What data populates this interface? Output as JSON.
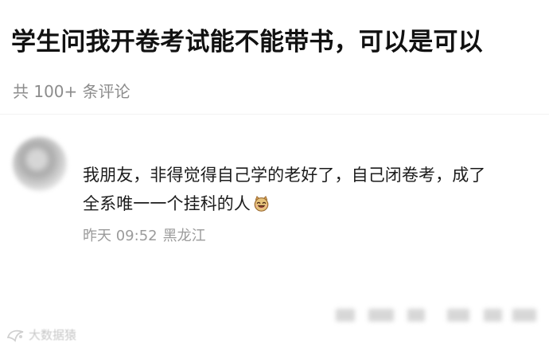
{
  "post": {
    "title": "学生问我开卷考试能不能带书，可以是可以",
    "comment_count": "共 100+ 条评论"
  },
  "comment": {
    "avatar": "blurred-avatar",
    "username": "",
    "text_line_1": "我朋友，非得觉得自己学的老好了，自己闭卷考，成了",
    "text_line_2": "全系唯一一个挂科的人",
    "emoji": "laughing-face-emoji",
    "time": "昨天 09:52",
    "location": "黑龙江"
  },
  "footer": {
    "watermark_text": "大数据猿",
    "watermark_icon": "watermark-logo-icon"
  },
  "colors": {
    "background": "#ffffff",
    "title": "#111111",
    "body_text": "#1b1b1b",
    "muted_text": "#8c8c8c",
    "meta_text": "#9b9b9b",
    "emoji_face": "#e7c47b"
  }
}
